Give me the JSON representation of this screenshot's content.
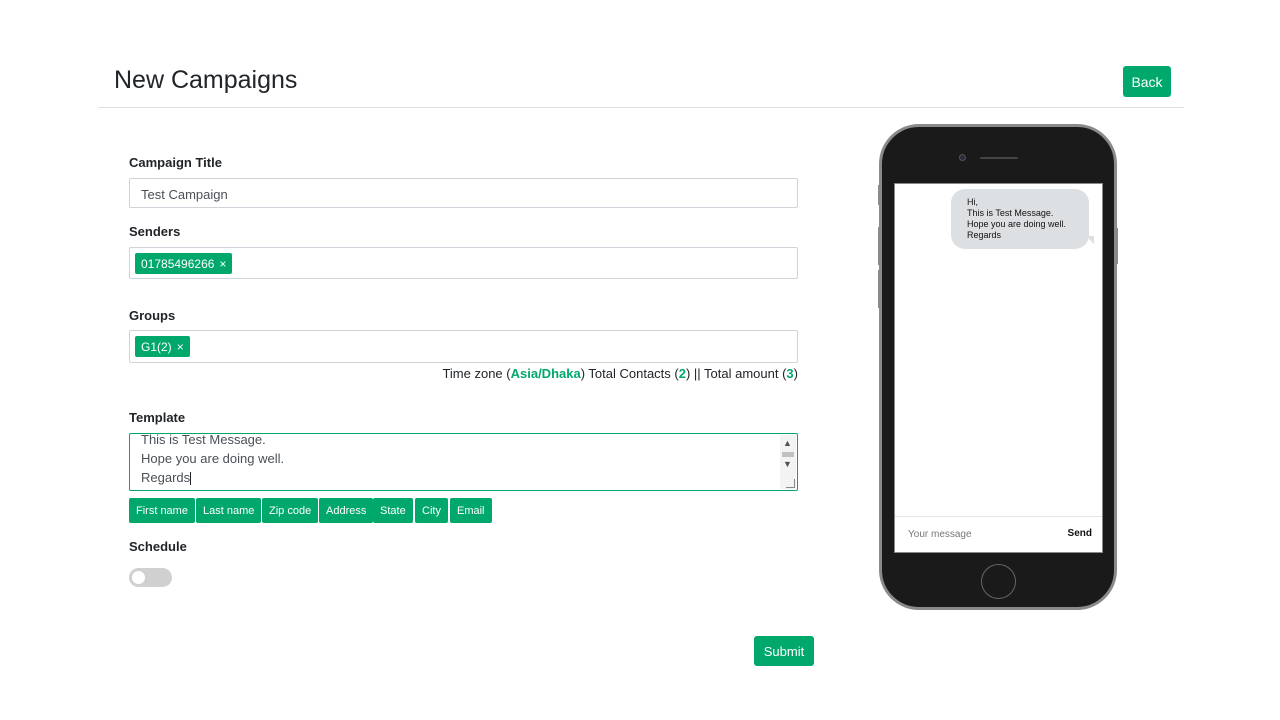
{
  "header": {
    "title": "New Campaigns",
    "back_label": "Back"
  },
  "form": {
    "campaign_title_label": "Campaign Title",
    "campaign_title_value": "Test Campaign",
    "senders_label": "Senders",
    "senders": [
      "01785496266"
    ],
    "groups_label": "Groups",
    "groups": [
      "G1(2)"
    ],
    "meta": {
      "timezone_prefix": "Time zone (",
      "timezone": "Asia/Dhaka",
      "contacts_prefix": ") Total Contacts (",
      "contacts": "2",
      "amount_prefix": ") || Total amount (",
      "amount": "3",
      "suffix": ")"
    },
    "template_label": "Template",
    "template_lines": [
      "This is Test Message.",
      "Hope you are doing well.",
      "Regards"
    ],
    "variables": [
      "First name",
      "Last name",
      "Zip code",
      "Address",
      "State",
      "City",
      "Email"
    ],
    "schedule_label": "Schedule",
    "schedule_enabled": false,
    "submit_label": "Submit",
    "remove_glyph": "×"
  },
  "preview": {
    "bubble_lines": [
      "Hi,",
      "This is Test Message.",
      "Hope you are doing well.",
      "Regards"
    ],
    "message_placeholder": "Your message",
    "send_label": "Send"
  },
  "colors": {
    "accent": "#00a86b"
  }
}
